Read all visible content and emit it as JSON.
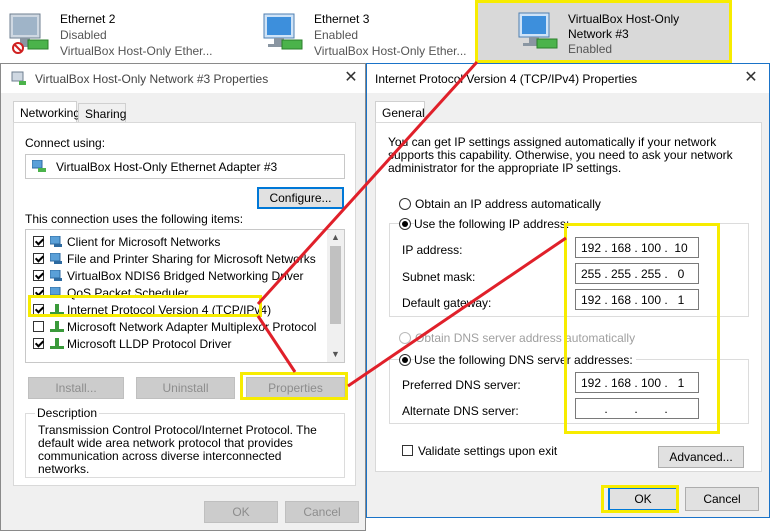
{
  "adapters": [
    {
      "name": "Ethernet 2",
      "status": "Disabled",
      "device": "VirtualBox Host-Only Ether..."
    },
    {
      "name": "Ethernet 3",
      "status": "Enabled",
      "device": "VirtualBox Host-Only Ether..."
    },
    {
      "name_line1": "VirtualBox Host-Only",
      "name_line2": "Network #3",
      "status": "Enabled"
    }
  ],
  "adapter_props": {
    "title": "VirtualBox Host-Only Network #3 Properties",
    "tabs": [
      "Networking",
      "Sharing"
    ],
    "connect_using_label": "Connect using:",
    "adapter_name": "VirtualBox Host-Only Ethernet Adapter #3",
    "configure_label": "Configure...",
    "items_label": "This connection uses the following items:",
    "items": [
      {
        "label": "Client for Microsoft Networks",
        "checked": true
      },
      {
        "label": "File and Printer Sharing for Microsoft Networks",
        "checked": true
      },
      {
        "label": "VirtualBox NDIS6 Bridged Networking Driver",
        "checked": true
      },
      {
        "label": "QoS Packet Scheduler",
        "checked": true
      },
      {
        "label": "Internet Protocol Version 4 (TCP/IPv4)",
        "checked": true
      },
      {
        "label": "Microsoft Network Adapter Multiplexor Protocol",
        "checked": false
      },
      {
        "label": "Microsoft LLDP Protocol Driver",
        "checked": true
      }
    ],
    "install_label": "Install...",
    "uninstall_label": "Uninstall",
    "properties_label": "Properties",
    "description_heading": "Description",
    "description_text": "Transmission Control Protocol/Internet Protocol. The default wide area network protocol that provides communication across diverse interconnected networks.",
    "ok_label": "OK",
    "cancel_label": "Cancel"
  },
  "ipv4": {
    "title": "Internet Protocol Version 4 (TCP/IPv4) Properties",
    "tab": "General",
    "intro": "You can get IP settings assigned automatically if your network supports this capability. Otherwise, you need to ask your network administrator for the appropriate IP settings.",
    "auto_ip_label": "Obtain an IP address automatically",
    "manual_ip_label": "Use the following IP address:",
    "ip_label": "IP address:",
    "ip": [
      "192",
      "168",
      "100",
      "10"
    ],
    "mask_label": "Subnet mask:",
    "mask": [
      "255",
      "255",
      "255",
      "0"
    ],
    "gateway_label": "Default gateway:",
    "gateway": [
      "192",
      "168",
      "100",
      "1"
    ],
    "auto_dns_label": "Obtain DNS server address automatically",
    "manual_dns_label": "Use the following DNS server addresses:",
    "pref_dns_label": "Preferred DNS server:",
    "pref_dns": [
      "192",
      "168",
      "100",
      "1"
    ],
    "alt_dns_label": "Alternate DNS server:",
    "alt_dns": [
      "",
      "",
      "",
      ""
    ],
    "validate_label": "Validate settings upon exit",
    "advanced_label": "Advanced...",
    "ok_label": "OK",
    "cancel_label": "Cancel"
  },
  "colors": {
    "highlight": "#f7ec00",
    "arrow": "#e0202a",
    "accent": "#0078d7"
  }
}
